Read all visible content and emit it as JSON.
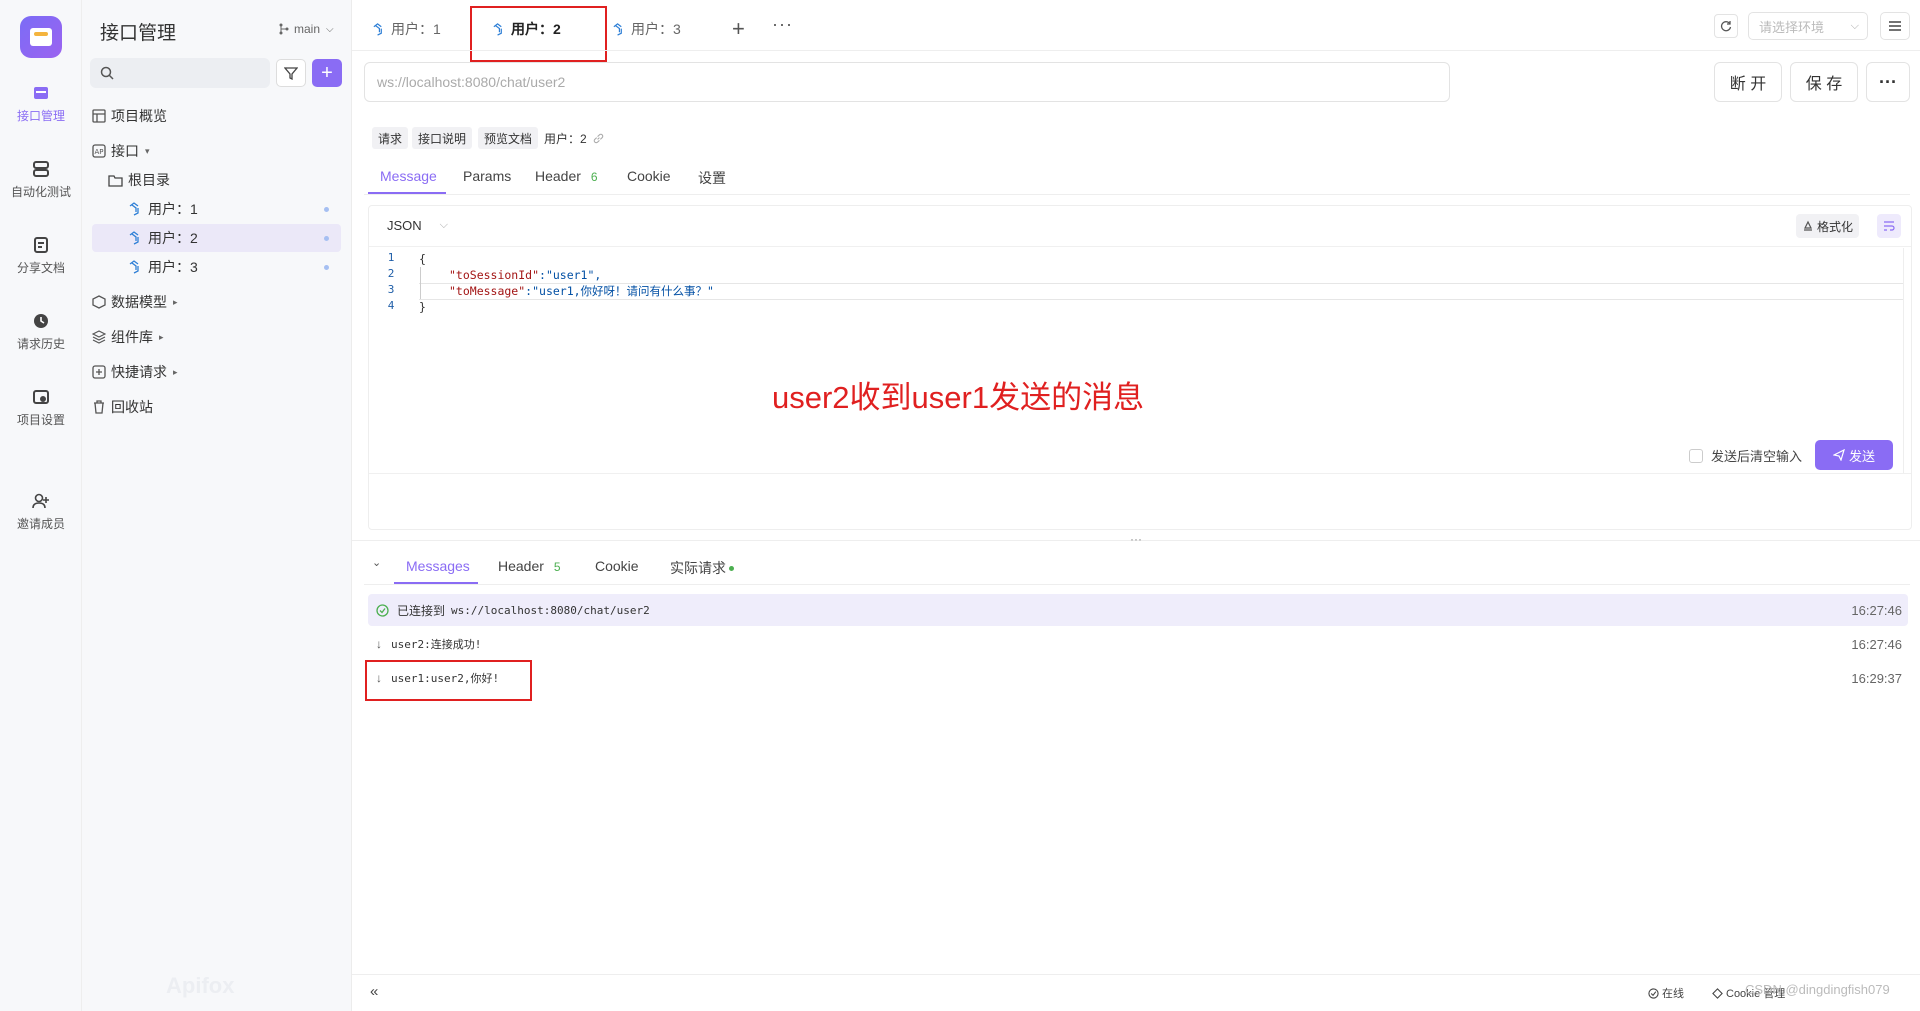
{
  "rail": {
    "items": [
      {
        "label": "接口管理",
        "icon": "api-management-icon"
      },
      {
        "label": "自动化测试",
        "icon": "automation-test-icon"
      },
      {
        "label": "分享文档",
        "icon": "share-docs-icon"
      },
      {
        "label": "请求历史",
        "icon": "history-icon"
      },
      {
        "label": "项目设置",
        "icon": "project-settings-icon"
      },
      {
        "label": "邀请成员",
        "icon": "invite-member-icon"
      }
    ]
  },
  "sidebar": {
    "title": "接口管理",
    "branch": "main",
    "search_placeholder": "",
    "nav": [
      {
        "label": "项目概览"
      },
      {
        "label": "接口"
      },
      {
        "label": "根目录"
      },
      {
        "label": "用户：1"
      },
      {
        "label": "用户：2"
      },
      {
        "label": "用户：3"
      },
      {
        "label": "数据模型"
      },
      {
        "label": "组件库"
      },
      {
        "label": "快捷请求"
      },
      {
        "label": "回收站"
      }
    ],
    "watermark": "Apifox"
  },
  "tabs": [
    {
      "label": "用户：1"
    },
    {
      "label": "用户：2"
    },
    {
      "label": "用户：3"
    }
  ],
  "env_select_placeholder": "请选择环境",
  "url": "ws://localhost:8080/chat/user2",
  "buttons": {
    "disconnect": "断 开",
    "save": "保 存"
  },
  "chips": [
    "请求",
    "接口说明",
    "预览文档",
    "用户：2"
  ],
  "request_tabs": [
    {
      "label": "Message"
    },
    {
      "label": "Params"
    },
    {
      "label": "Header",
      "count": "6"
    },
    {
      "label": "Cookie"
    },
    {
      "label": "设置"
    }
  ],
  "editor": {
    "format": "JSON",
    "format_button": "格式化",
    "lines": [
      "1",
      "2",
      "3",
      "4"
    ],
    "code": {
      "l1": "{",
      "l2_key": "\"toSessionId\"",
      "l2_val": ":\"user1\",",
      "l3_key": "\"toMessage\"",
      "l3_val": ":\"user1,你好呀！请问有什么事？\"",
      "l4": "}"
    }
  },
  "annotation": "user2收到user1发送的消息",
  "send_area": {
    "clear_after_send": "发送后清空输入",
    "send": "发送"
  },
  "response_tabs": [
    {
      "label": "Messages"
    },
    {
      "label": "Header",
      "count": "5"
    },
    {
      "label": "Cookie"
    },
    {
      "label": "实际请求"
    }
  ],
  "messages": [
    {
      "prefix": "已连接到",
      "text": "ws://localhost:8080/chat/user2",
      "time": "16:27:46"
    },
    {
      "text": "user2:连接成功!",
      "time": "16:27:46"
    },
    {
      "text": "user1:user2,你好!",
      "time": "16:29:37"
    }
  ],
  "footer": {
    "online": "在线",
    "cookie": "Cookie 管理",
    "credit": "CSDN @dingdingfish079"
  },
  "colors": {
    "accent": "#8a6cf4",
    "highlight": "#e02020",
    "selected": "#ebe8f8"
  }
}
